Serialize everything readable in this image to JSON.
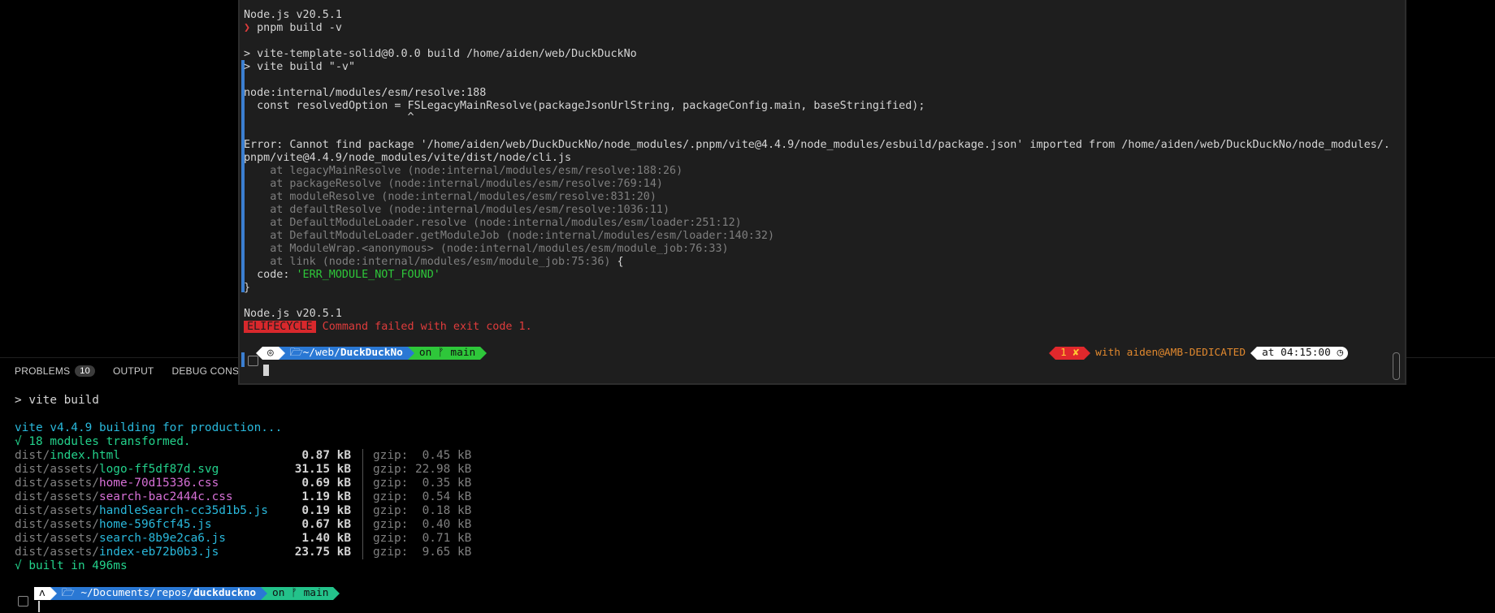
{
  "panel": {
    "tabs": [
      {
        "label": "PROBLEMS",
        "count": "10"
      },
      {
        "label": "OUTPUT"
      },
      {
        "label": "DEBUG CONSOLE"
      }
    ],
    "command": "> vite build",
    "build_line": "vite v4.4.9 building for production...",
    "transformed": "√ 18 modules transformed.",
    "files": [
      {
        "dir": "dist/",
        "name": "index.html",
        "size": "0.87 kB",
        "gzip": "gzip:  0.45 kB",
        "color": "#23d18b"
      },
      {
        "dir": "dist/assets/",
        "name": "logo-ff5df87d.svg",
        "size": "31.15 kB",
        "gzip": "gzip: 22.98 kB",
        "color": "#23d18b"
      },
      {
        "dir": "dist/assets/",
        "name": "home-70d15336.css",
        "size": "0.69 kB",
        "gzip": "gzip:  0.35 kB",
        "color": "#d670d6"
      },
      {
        "dir": "dist/assets/",
        "name": "search-bac2444c.css",
        "size": "1.19 kB",
        "gzip": "gzip:  0.54 kB",
        "color": "#d670d6"
      },
      {
        "dir": "dist/assets/",
        "name": "handleSearch-cc35d1b5.js",
        "size": "0.19 kB",
        "gzip": "gzip:  0.18 kB",
        "color": "#29b8db"
      },
      {
        "dir": "dist/assets/",
        "name": "home-596fcf45.js",
        "size": "0.67 kB",
        "gzip": "gzip:  0.40 kB",
        "color": "#29b8db"
      },
      {
        "dir": "dist/assets/",
        "name": "search-8b9e2ca6.js",
        "size": "1.40 kB",
        "gzip": "gzip:  0.71 kB",
        "color": "#29b8db"
      },
      {
        "dir": "dist/assets/",
        "name": "index-eb72b0b3.js",
        "size": "23.75 kB",
        "gzip": "gzip:  9.65 kB",
        "color": "#29b8db"
      }
    ],
    "built": "√ built in 496ms",
    "prompt": {
      "os_icon": "ʌ",
      "folder_icon": "🗁",
      "path_prefix": "~/Documents/repos/",
      "path_bold": "duckduckno",
      "git_label": "on",
      "git_branch_icon": "ᚠ",
      "branch": "main"
    }
  },
  "terminal": {
    "lines": {
      "node1": "Node.js v20.5.1",
      "cmd_prompt": "❯",
      "cmd": " pnpm build -v",
      "script1": "> vite-template-solid@0.0.0 build /home/aiden/web/DuckDuckNo",
      "script2": "> vite build \"-v\"",
      "internal": "node:internal/modules/esm/resolve:188",
      "code": "  const resolvedOption = FSLegacyMainResolve(packageJsonUrlString, packageConfig.main, baseStringified);",
      "caret": "                         ^",
      "error1": "Error: Cannot find package '/home/aiden/web/DuckDuckNo/node_modules/.pnpm/vite@4.4.9/node_modules/esbuild/package.json' imported from /home/aiden/web/DuckDuckNo/node_modules/.",
      "error2": "pnpm/vite@4.4.9/node_modules/vite/dist/node/cli.js",
      "code_key": "  code: ",
      "code_val": "'ERR_MODULE_NOT_FOUND'",
      "close_brace": "}",
      "node2": "Node.js v20.5.1",
      "elife": "ELIFECYCLE",
      "elife_msg": " Command failed with exit code 1."
    },
    "stack": [
      "    at legacyMainResolve (node:internal/modules/esm/resolve:188:26)",
      "    at packageResolve (node:internal/modules/esm/resolve:769:14)",
      "    at moduleResolve (node:internal/modules/esm/resolve:831:20)",
      "    at defaultResolve (node:internal/modules/esm/resolve:1036:11)",
      "    at DefaultModuleLoader.resolve (node:internal/modules/esm/loader:251:12)",
      "    at DefaultModuleLoader.getModuleJob (node:internal/modules/esm/loader:140:32)",
      "    at ModuleWrap.<anonymous> (node:internal/modules/esm/module_job:76:33)",
      "    at link (node:internal/modules/esm/module_job:75:36) {"
    ],
    "prompt": {
      "os_icon": "◎",
      "folder_icon": "🗁",
      "path_prefix": "~/web/",
      "path_bold": "DuckDuckNo",
      "git_label": "on",
      "git_branch_icon": "ᚠ",
      "branch": "main",
      "exit_code": "1",
      "exit_icon": "✘",
      "user": "with aiden@AMB-DEDICATED",
      "time": "at 04:15:00",
      "clock_icon": "◷"
    }
  },
  "colors": {
    "os_segment": "#ffffff",
    "path_segment": "#2a78d4",
    "git_segment": "#2ec73a",
    "git_segment_panel": "#23c28a",
    "error_segment": "#e0282c",
    "user_text": "#e0882e",
    "time_segment": "#ffffff"
  }
}
